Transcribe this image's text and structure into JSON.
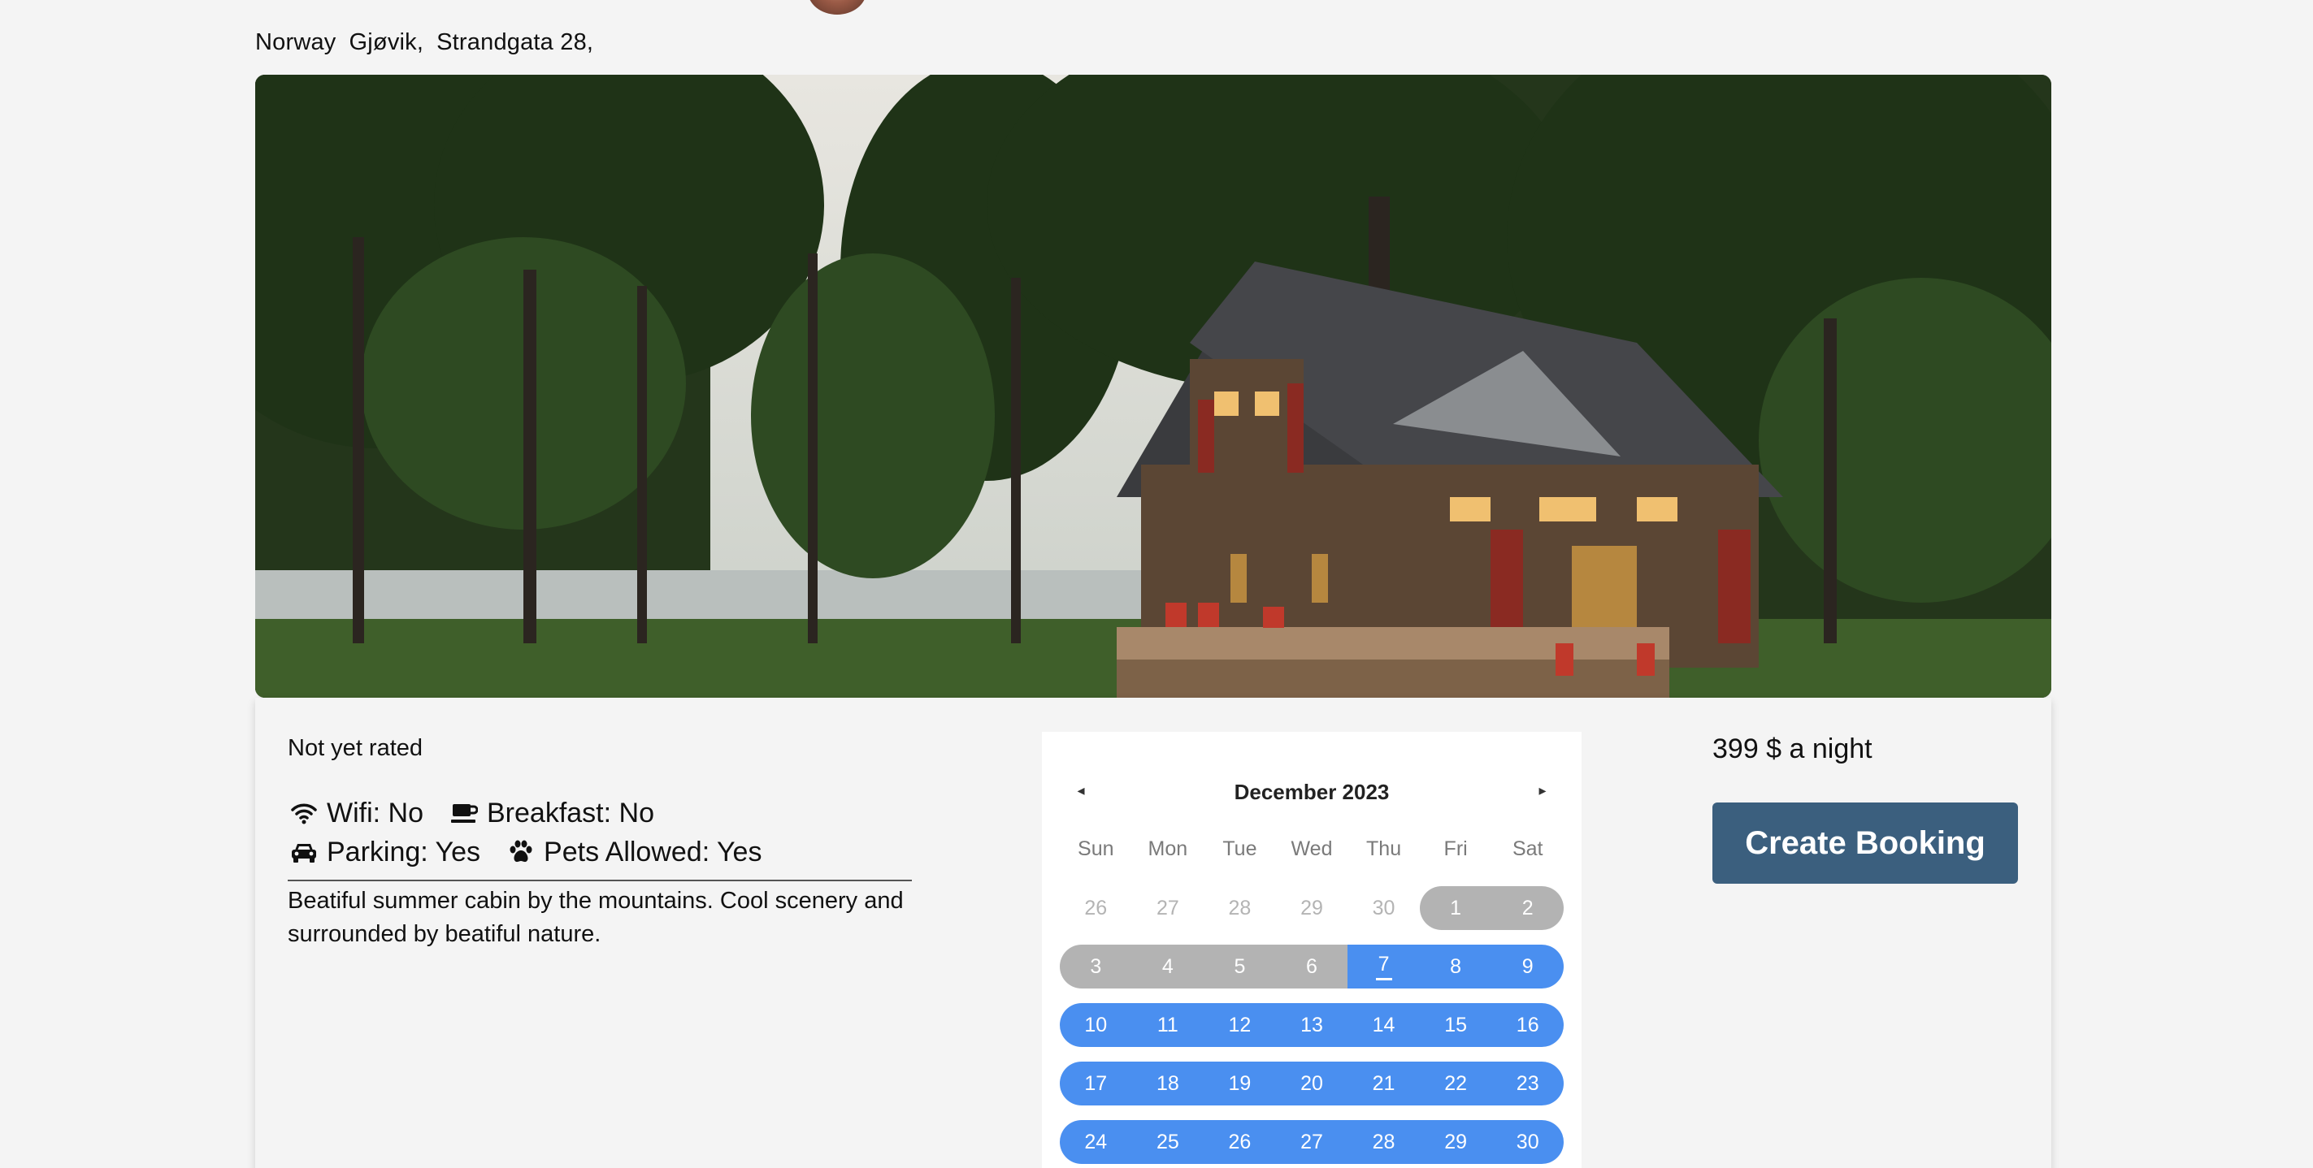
{
  "location": {
    "country": "Norway",
    "city": "Gjøvik,",
    "street": "Strandgata 28,"
  },
  "listing": {
    "rating": "Not yet rated",
    "amenities": {
      "wifi": "Wifi: No",
      "breakfast": "Breakfast: No",
      "parking": "Parking: Yes",
      "pets": "Pets Allowed: Yes"
    },
    "description": "Beatiful summer cabin by the mountains. Cool scenery and surrounded by beatiful nature.",
    "price": "399 $ a night"
  },
  "calendar": {
    "title": "December 2023",
    "prev_symbol": "◂",
    "next_symbol": "▸",
    "weekdays": [
      "Sun",
      "Mon",
      "Tue",
      "Wed",
      "Thu",
      "Fri",
      "Sat"
    ],
    "weeks": [
      [
        "26",
        "27",
        "28",
        "29",
        "30",
        "1",
        "2"
      ],
      [
        "3",
        "4",
        "5",
        "6",
        "7",
        "8",
        "9"
      ],
      [
        "10",
        "11",
        "12",
        "13",
        "14",
        "15",
        "16"
      ],
      [
        "17",
        "18",
        "19",
        "20",
        "21",
        "22",
        "23"
      ],
      [
        "24",
        "25",
        "26",
        "27",
        "28",
        "29",
        "30"
      ]
    ]
  },
  "actions": {
    "book_label": "Create Booking"
  },
  "colors": {
    "range_selected": "#4a8ff0",
    "unavailable": "#b3b3b3",
    "button": "#3b5f7e"
  }
}
